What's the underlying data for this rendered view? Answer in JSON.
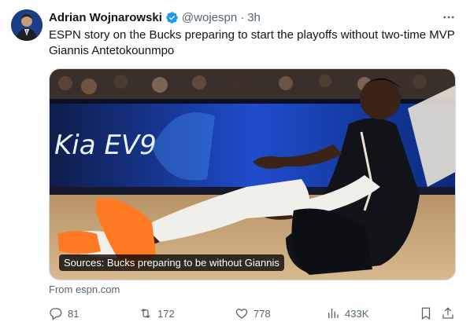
{
  "tweet": {
    "author_name": "Adrian Wojnarowski",
    "handle": "@wojespn",
    "separator": "·",
    "time": "3h",
    "more_label": "···",
    "text": "ESPN story on the Bucks preparing to start the playoffs without two-time MVP Giannis Antetokounmpo",
    "media": {
      "caption": "Sources: Bucks preparing to be without Giannis",
      "board_text": "Kia EV9"
    },
    "source": "From espn.com",
    "actions": {
      "replies": "81",
      "retweets": "172",
      "likes": "778",
      "views": "433K"
    }
  },
  "colors": {
    "verified": "#1d9bf0",
    "muted": "#536471",
    "text": "#0f1419"
  },
  "icons": [
    "verified-badge-icon",
    "more-icon",
    "reply-icon",
    "retweet-icon",
    "like-icon",
    "views-icon",
    "bookmark-icon",
    "share-icon"
  ]
}
